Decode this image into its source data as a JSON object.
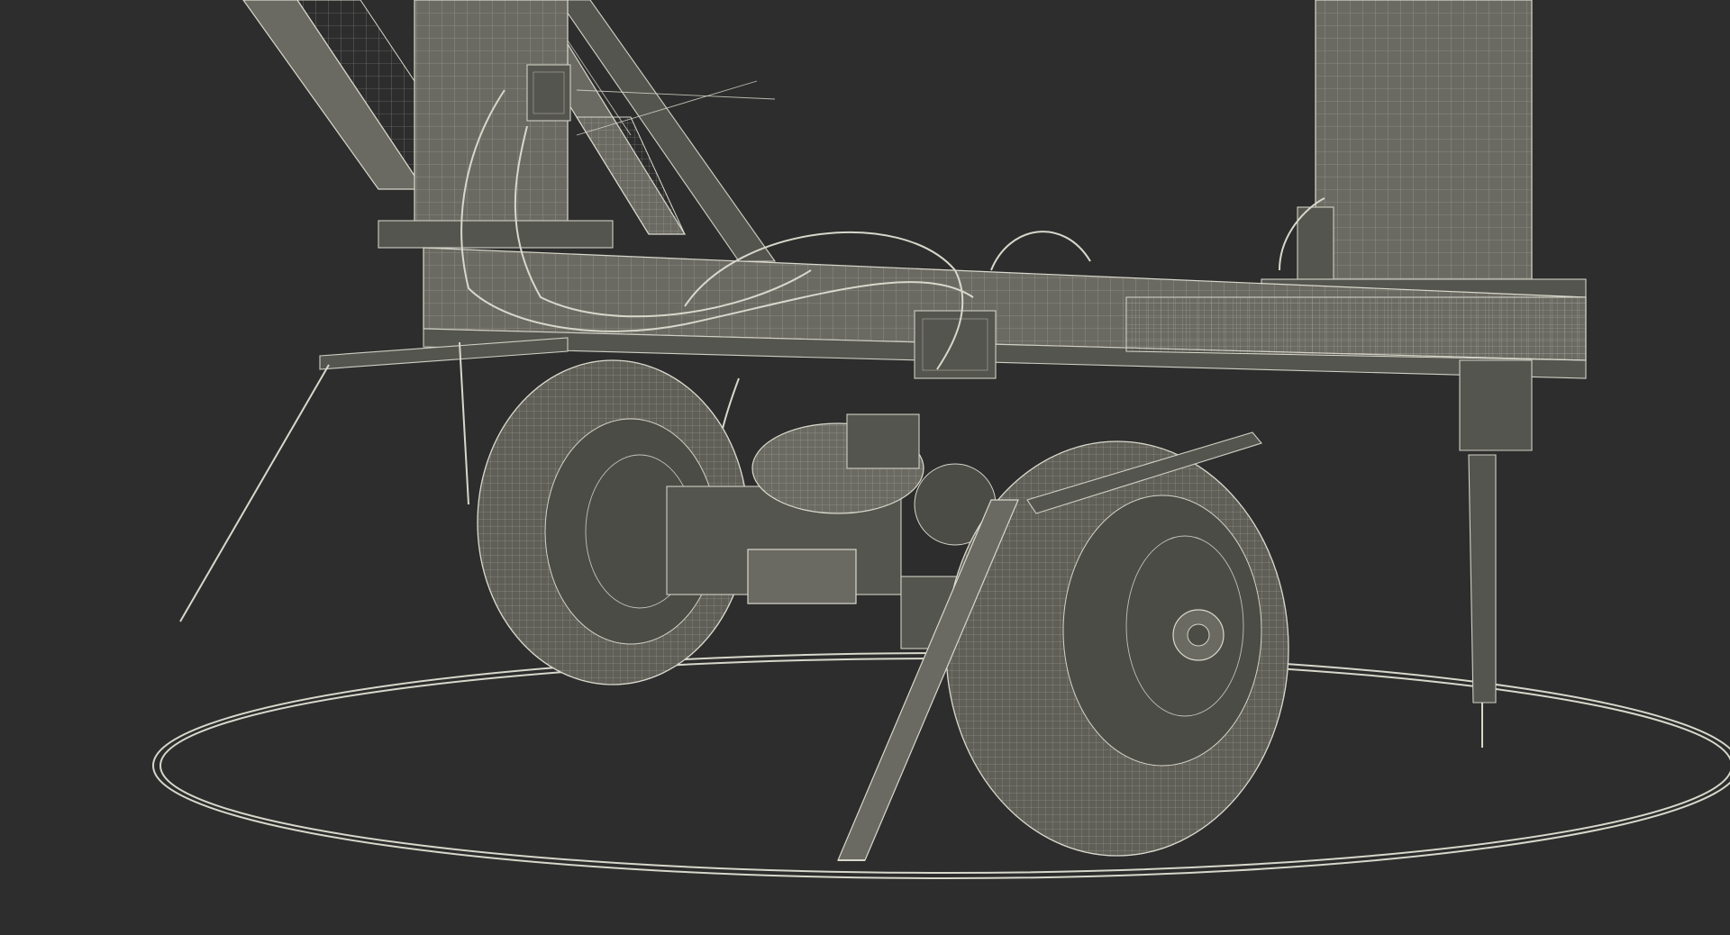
{
  "scene": {
    "description_label": "",
    "background_color": "#2d2d2d",
    "wire_color": "#d8d8cc",
    "surface_color": "#6a6a62"
  }
}
